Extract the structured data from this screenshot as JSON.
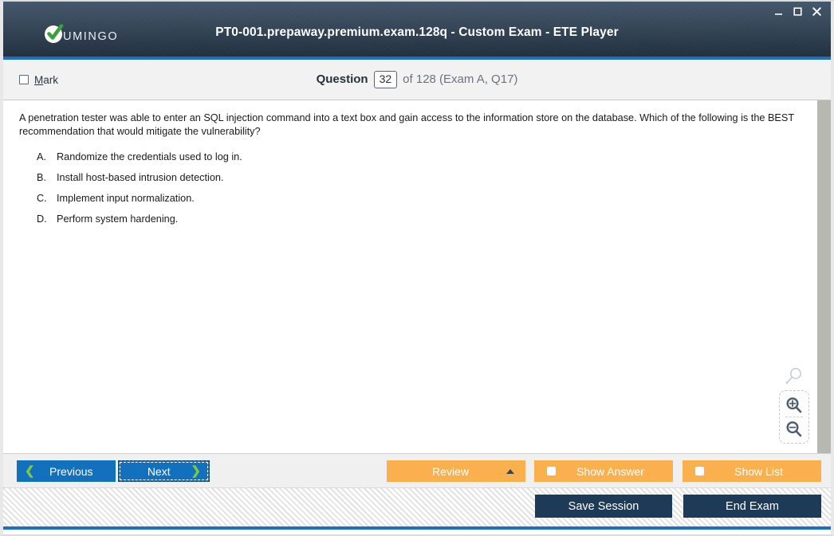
{
  "window": {
    "title": "PT0-001.prepaway.premium.exam.128q - Custom Exam - ETE Player",
    "logo_text": "UMINGO",
    "logo_icon": "check-circle-icon",
    "controls": {
      "minimize": "minimize-icon",
      "maximize": "maximize-icon",
      "close": "close-icon"
    },
    "accent_blue": "#1b6fc4",
    "titlebar_navy": "#2d3d4e"
  },
  "question_header": {
    "mark_label": "Mark",
    "mark_accel": "M",
    "mark_checked": false,
    "question_word": "Question",
    "question_number": "32",
    "rest": "of 128 (Exam A, Q17)",
    "total": "128",
    "exam_ref": "Exam A, Q17"
  },
  "question": {
    "text": "A penetration tester was able to enter an SQL injection command into a text box and gain access to the information store on the database. Which of the following is the BEST recommendation that would mitigate the vulnerability?",
    "options": [
      {
        "letter": "A.",
        "text": "Randomize the credentials used to log in."
      },
      {
        "letter": "B.",
        "text": "Install host-based intrusion detection."
      },
      {
        "letter": "C.",
        "text": "Implement input normalization."
      },
      {
        "letter": "D.",
        "text": "Perform system hardening."
      }
    ]
  },
  "zoom_widget": {
    "search_icon": "magnifier-icon",
    "zoom_in_icon": "magnifier-plus-icon",
    "zoom_out_icon": "magnifier-minus-icon"
  },
  "action_bar": {
    "previous_label": "Previous",
    "next_label": "Next",
    "review_label": "Review",
    "show_answer_label": "Show Answer",
    "show_list_label": "Show List",
    "button_blue": "#1270bd",
    "button_orange": "#fbb04e"
  },
  "footer": {
    "save_session_label": "Save Session",
    "end_exam_label": "End Exam",
    "button_navy": "#1d3a56"
  }
}
